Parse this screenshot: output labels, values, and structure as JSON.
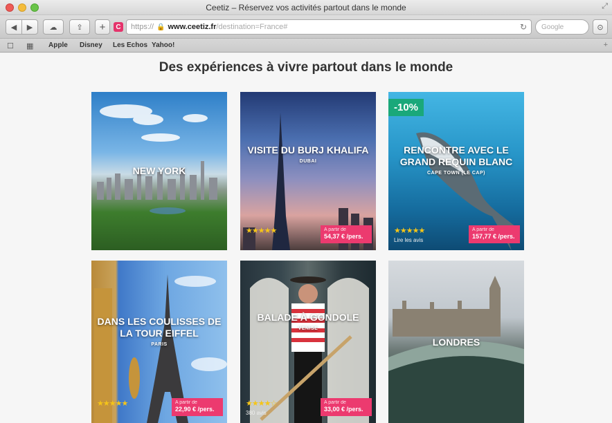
{
  "window": {
    "title": "Ceetiz – Réservez vos activités partout dans le monde"
  },
  "toolbar": {
    "url_proto": "https://",
    "url_host": "www.ceetiz.fr",
    "url_path": "/destination=France#",
    "search_placeholder": "Google"
  },
  "bookmarks": [
    {
      "label": "Apple"
    },
    {
      "label": "Disney"
    },
    {
      "label": "Les Echos"
    },
    {
      "label": "Yahoo!"
    }
  ],
  "page": {
    "title": "Des expériences à vivre partout dans le monde"
  },
  "cards": [
    {
      "title": "NEW YORK",
      "subtitle": ""
    },
    {
      "title": "VISITE DU BURJ KHALIFA",
      "subtitle": "DUBAI",
      "stars": "★★★★★",
      "rating": 4.5,
      "price_from": "A partir de",
      "price": "54,37 € /pers."
    },
    {
      "title": "RENCONTRE AVEC LE GRAND REQUIN BLANC",
      "subtitle": "CAPE TOWN (LE CAP)",
      "stars": "★★★★★",
      "rating": 5,
      "reviews": "Lire les avis",
      "price_from": "A partir de",
      "price": "157,77 € /pers.",
      "discount": "-10%"
    },
    {
      "title": "DANS LES COULISSES DE LA TOUR EIFFEL",
      "subtitle": "PARIS",
      "stars": "★★★★★",
      "rating": 4.5,
      "price_from": "A partir de",
      "price": "22,90 € /pers."
    },
    {
      "title": "BALADE À GONDOLE",
      "subtitle": "VENISE",
      "stars": "★★★★☆",
      "rating": 4,
      "reviews": "380 avis",
      "price_from": "A partir de",
      "price": "33,00 € /pers."
    },
    {
      "title": "LONDRES",
      "subtitle": ""
    }
  ],
  "colors": {
    "price_tag": "#ec3a6f",
    "discount_badge": "#1aa87a",
    "stars": "#f5c518"
  }
}
